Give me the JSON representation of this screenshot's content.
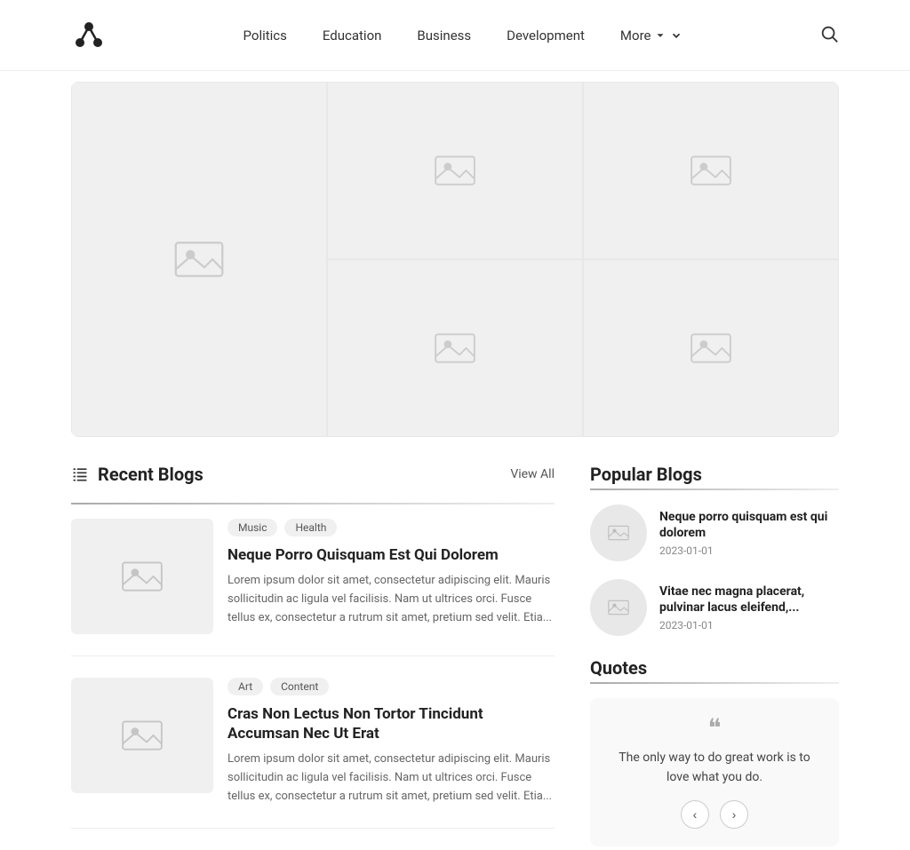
{
  "nav": {
    "logo_alt": "Logo",
    "links": [
      {
        "label": "Politics",
        "id": "politics"
      },
      {
        "label": "Education",
        "id": "education"
      },
      {
        "label": "Business",
        "id": "business"
      },
      {
        "label": "Development",
        "id": "development"
      },
      {
        "label": "More",
        "id": "more"
      }
    ],
    "search_aria": "Search"
  },
  "recent_blogs": {
    "section_title": "Recent Blogs",
    "view_all": "View All",
    "cards": [
      {
        "tags": [
          "Music",
          "Health"
        ],
        "title": "Neque Porro Quisquam Est Qui Dolorem",
        "excerpt": "Lorem ipsum dolor sit amet, consectetur adipiscing elit. Mauris sollicitudin ac ligula vel facilisis. Nam ut ultrices orci. Fusce tellus ex, consectetur a rutrum sit amet, pretium sed velit. Etia..."
      },
      {
        "tags": [
          "Art",
          "Content"
        ],
        "title": "Cras Non Lectus Non Tortor Tincidunt Accumsan Nec Ut Erat",
        "excerpt": "Lorem ipsum dolor sit amet, consectetur adipiscing elit. Mauris sollicitudin ac ligula vel facilisis. Nam ut ultrices orci. Fusce tellus ex, consectetur a rutrum sit amet, pretium sed velit. Etia..."
      }
    ]
  },
  "popular_blogs": {
    "section_title": "Popular Blogs",
    "items": [
      {
        "title": "Neque porro quisquam est qui dolorem",
        "date": "2023-01-01"
      },
      {
        "title": "Vitae nec magna placerat, pulvinar lacus eleifend,...",
        "date": "2023-01-01"
      }
    ]
  },
  "quotes": {
    "section_title": "Quotes",
    "text": "The only way to do great work is to love what you do.",
    "prev_label": "‹",
    "next_label": "›"
  }
}
